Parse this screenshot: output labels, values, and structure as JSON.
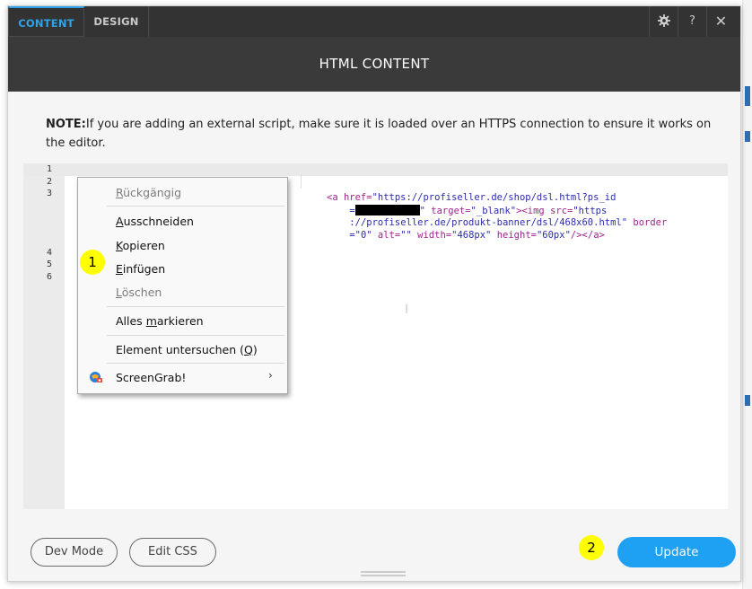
{
  "tabs": [
    {
      "label": "CONTENT",
      "active": true
    },
    {
      "label": "DESIGN",
      "active": false
    }
  ],
  "toolbar": {
    "settings_icon": "gear-icon",
    "help_label": "?",
    "close_label": "✕"
  },
  "dialog": {
    "title": "HTML CONTENT"
  },
  "note": {
    "label": "NOTE:",
    "text": "If you are adding an external script, make sure it is loaded over an HTTPS connection to ensure it works on the editor."
  },
  "editor": {
    "line_numbers": [
      "1",
      "2",
      "3",
      "4",
      "5",
      "6"
    ],
    "code": {
      "l1_open": "<a ",
      "l1_href_attr": "href=",
      "l1_href_val": "\"https://profiseller.de/shop/dsl.html?ps_id",
      "l2_eq": "=",
      "l2_after": "\" ",
      "l2_target_attr": "target=",
      "l2_target_val": "\"_blank\"",
      "l2_img_open": "><img ",
      "l2_src_attr": "src=",
      "l2_src_val": "\"https",
      "l3_src_cont": "://profiseller.de/produkt-banner/dsl/468x60.html\"",
      "l3_border_attr": " border",
      "l4_border_val": "=\"0\"",
      "l4_alt_attr": " alt=",
      "l4_alt_val": "\"\"",
      "l4_width_attr": " width=",
      "l4_width_val": "\"468px\"",
      "l4_height_attr": " height=",
      "l4_height_val": "\"60px\"",
      "l4_close": "/></a>"
    }
  },
  "context_menu": {
    "undo": "Rückgängig",
    "cut": "Ausschneiden",
    "copy": "Kopieren",
    "paste": "Einfügen",
    "delete": "Löschen",
    "select_all": "Alles markieren",
    "inspect": "Element untersuchen (Q)",
    "screengrab": "ScreenGrab!",
    "submenu_chevron": "›"
  },
  "badges": {
    "first": "1",
    "second": "2"
  },
  "footer": {
    "dev_mode": "Dev Mode",
    "edit_css": "Edit CSS",
    "update": "Update"
  },
  "colors": {
    "accent": "#1ea1f2",
    "header_bg": "#333333",
    "badge": "#ffff00"
  }
}
